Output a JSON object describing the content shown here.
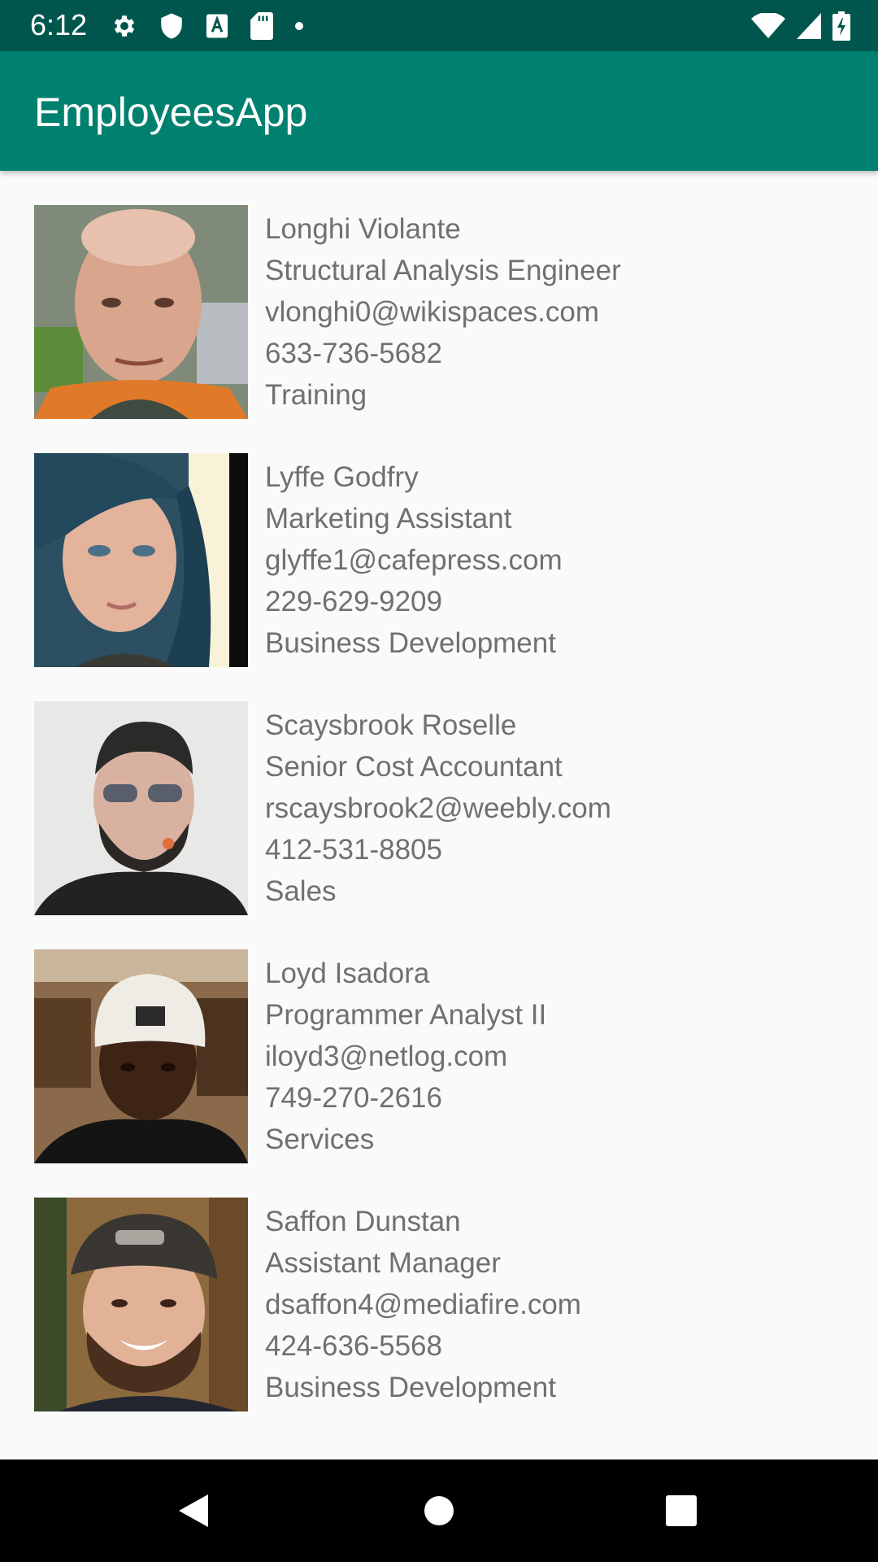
{
  "status_bar": {
    "time": "6:12",
    "icons_left": [
      "settings-icon",
      "shield-icon",
      "font-icon",
      "sd-card-icon",
      "dot-icon"
    ],
    "icons_right": [
      "wifi-icon",
      "signal-icon",
      "battery-charging-icon"
    ]
  },
  "app_bar": {
    "title": "EmployeesApp",
    "background_color": "#00806f",
    "status_color": "#00564d"
  },
  "employees": [
    {
      "name": "Longhi Violante",
      "title": "Structural Analysis Engineer",
      "email": "vlonghi0@wikispaces.com",
      "phone": "633-736-5682",
      "department": "Training",
      "photo": "employee-photo"
    },
    {
      "name": "Lyffe Godfry",
      "title": "Marketing Assistant",
      "email": "glyffe1@cafepress.com",
      "phone": "229-629-9209",
      "department": "Business Development",
      "photo": "employee-photo"
    },
    {
      "name": "Scaysbrook Roselle",
      "title": "Senior Cost Accountant",
      "email": "rscaysbrook2@weebly.com",
      "phone": "412-531-8805",
      "department": "Sales",
      "photo": "employee-photo"
    },
    {
      "name": "Loyd Isadora",
      "title": "Programmer Analyst II",
      "email": "iloyd3@netlog.com",
      "phone": "749-270-2616",
      "department": "Services",
      "photo": "employee-photo"
    },
    {
      "name": "Saffon Dunstan",
      "title": "Assistant Manager",
      "email": "dsaffon4@mediafire.com",
      "phone": "424-636-5568",
      "department": "Business Development",
      "photo": "employee-photo"
    }
  ],
  "nav_bar": {
    "buttons": [
      "back-icon",
      "home-icon",
      "recents-icon"
    ]
  }
}
